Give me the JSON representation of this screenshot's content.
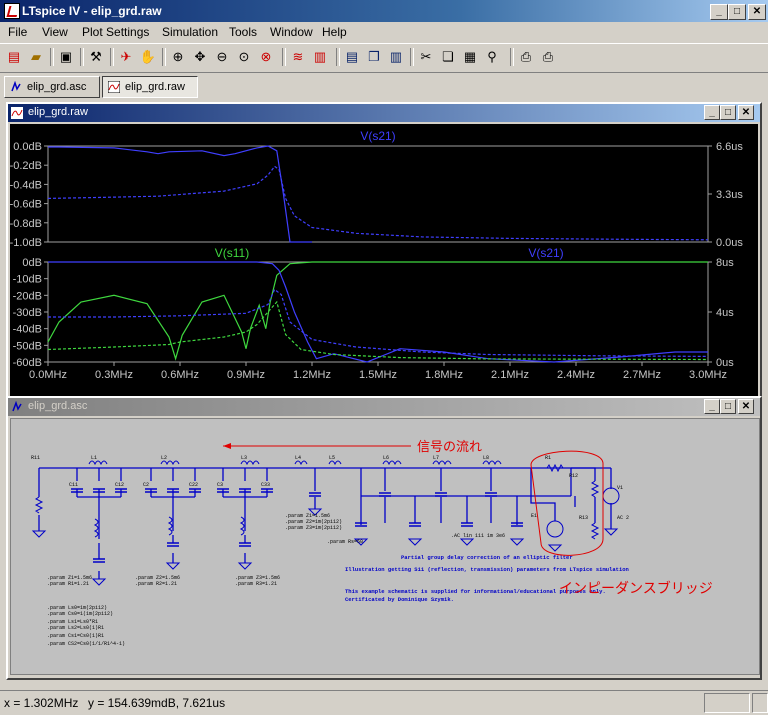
{
  "window": {
    "title": "LTspice IV - elip_grd.raw"
  },
  "menu": [
    "File",
    "View",
    "Plot Settings",
    "Simulation",
    "Tools",
    "Window",
    "Help"
  ],
  "tabs": [
    {
      "label": "elip_grd.asc",
      "active": false
    },
    {
      "label": "elip_grd.raw",
      "active": true
    }
  ],
  "plot_window": {
    "title": "elip_grd.raw",
    "top_pane": {
      "trace_label": "V(s21)",
      "y_ticks": [
        "0.0dB",
        "-0.2dB",
        "-0.4dB",
        "-0.6dB",
        "-0.8dB",
        "-1.0dB"
      ],
      "y2_ticks": [
        "6.6us",
        "3.3us",
        "0.0us"
      ]
    },
    "bottom_pane": {
      "trace_labels": [
        "V(s11)",
        "V(s21)"
      ],
      "y_ticks": [
        "0dB",
        "-10dB",
        "-20dB",
        "-30dB",
        "-40dB",
        "-50dB",
        "-60dB"
      ],
      "y2_ticks": [
        "8us",
        "4us",
        "0us"
      ],
      "x_ticks": [
        "0.0MHz",
        "0.3MHz",
        "0.6MHz",
        "0.9MHz",
        "1.2MHz",
        "1.5MHz",
        "1.8MHz",
        "2.1MHz",
        "2.4MHz",
        "2.7MHz",
        "3.0MHz"
      ]
    },
    "colors": {
      "s21": "#3f3fff",
      "s11": "#3fd83f",
      "axis": "#a0a0a0",
      "label_text": "#c8c8c8"
    }
  },
  "chart_data": [
    {
      "type": "line",
      "title": "",
      "xlabel": "",
      "ylabel": "",
      "xlim": [
        0,
        3.0
      ],
      "ylim": [
        -1.0,
        0.0
      ],
      "y2lim": [
        0,
        6.6
      ],
      "x_unit": "MHz",
      "y_unit": "dB",
      "y2_unit": "us",
      "grid": false,
      "series": [
        {
          "name": "V(s21)",
          "axis": "y",
          "style": "solid",
          "x": [
            0,
            0.05,
            0.3,
            0.45,
            0.5,
            0.55,
            0.7,
            0.8,
            0.85,
            0.95,
            1.0,
            1.04,
            1.07,
            1.1,
            1.15,
            1.2
          ],
          "y": [
            -0.01,
            -0.01,
            -0.02,
            -0.06,
            -0.08,
            -0.06,
            -0.05,
            -0.1,
            -0.08,
            -0.02,
            0.0,
            -0.05,
            -0.5,
            -1.0,
            -1.0,
            -1.0
          ]
        },
        {
          "name": "V(s21)",
          "axis": "y2",
          "style": "dashed",
          "x": [
            0,
            0.2,
            0.5,
            0.8,
            0.95,
            1.0,
            1.03,
            1.05,
            1.08,
            1.12,
            1.2,
            1.4,
            1.7,
            2.1,
            2.5,
            3.0
          ],
          "y": [
            3.0,
            3.05,
            3.15,
            3.5,
            4.0,
            4.6,
            5.2,
            5.0,
            3.0,
            1.8,
            1.0,
            0.6,
            0.35,
            0.25,
            0.2,
            0.15
          ]
        }
      ]
    },
    {
      "type": "line",
      "title": "",
      "xlabel": "",
      "ylabel": "",
      "xlim": [
        0,
        3.0
      ],
      "ylim": [
        -60,
        0
      ],
      "y2lim": [
        0,
        8
      ],
      "x_unit": "MHz",
      "y_unit": "dB",
      "y2_unit": "us",
      "grid": false,
      "series": [
        {
          "name": "V(s11)",
          "axis": "y",
          "style": "solid",
          "x": [
            0,
            0.05,
            0.15,
            0.3,
            0.45,
            0.55,
            0.58,
            0.61,
            0.7,
            0.8,
            0.88,
            0.9,
            0.92,
            0.96,
            0.99,
            1.01,
            1.04,
            1.1,
            1.2,
            1.5,
            2.0,
            3.0
          ],
          "y": [
            -48,
            -36,
            -24,
            -20,
            -25,
            -45,
            -58,
            -44,
            -24,
            -20,
            -42,
            -52,
            -40,
            -26,
            -40,
            -24,
            -8,
            -1,
            0,
            0,
            0,
            0
          ]
        },
        {
          "name": "V(s21)",
          "axis": "y",
          "style": "solid",
          "x": [
            0,
            0.5,
            0.95,
            1.02,
            1.05,
            1.08,
            1.12,
            1.18,
            1.22,
            1.3,
            1.45,
            1.6,
            1.8,
            2.0,
            2.3,
            2.6,
            2.85,
            3.0
          ],
          "y": [
            0,
            0,
            0,
            -1,
            -5,
            -15,
            -30,
            -48,
            -58,
            -55,
            -60,
            -52,
            -54,
            -58,
            -60,
            -57,
            -54,
            -54
          ]
        },
        {
          "name": "V(s21)",
          "axis": "y2",
          "style": "dashed",
          "x": [
            0,
            0.3,
            0.6,
            0.9,
            1.0,
            1.03,
            1.06,
            1.1,
            1.2,
            1.4,
            1.7,
            2.0,
            2.5,
            3.0
          ],
          "y": [
            3.6,
            3.6,
            3.7,
            3.9,
            4.6,
            5.8,
            5.4,
            3.2,
            1.8,
            1.2,
            0.8,
            0.6,
            0.5,
            0.45
          ]
        },
        {
          "name": "V(s11)",
          "axis": "y2",
          "style": "dashed",
          "x": [
            0,
            0.3,
            0.55,
            0.6,
            0.8,
            0.9,
            0.95,
            1.0,
            1.04,
            1.08,
            1.15,
            1.3,
            1.6,
            2.0,
            3.0
          ],
          "y": [
            1.0,
            1.2,
            1.4,
            1.6,
            2.0,
            2.4,
            3.0,
            4.0,
            4.8,
            2.2,
            1.0,
            0.6,
            0.35,
            0.25,
            0.2
          ]
        }
      ]
    }
  ],
  "schematic_window": {
    "title": "elip_grd.asc",
    "annotation_signal_flow": "信号の流れ",
    "annotation_bridge": "インピーダンスブリッジ",
    "comment_lines": [
      "Partial group delay correction of an elliptic filter",
      "Illustration getting S11 (reflection, transmission) parameters from LTspice simulation",
      "This example schematic is supplied for informational/educational purposes only.",
      "Certificated by Dominique Szymik."
    ],
    "params": [
      ".param Z1=1.5m6",
      ".param R1=1.21",
      ".param Z2=1.5m6",
      ".param R2=1.21",
      ".param Z3=1.5m6",
      ".param R3=1.21",
      ".param Z1=1.5m6",
      ".param Z2=1m(2pi12)",
      ".param Z3=1m(2pi12)",
      ".param Rs=50",
      ".AC lin 111 1m 3e6",
      ".param Ls0=1m(2pi12)",
      ".param Cs0=1(1m(2pi12)",
      ".param Ls1=Ls0*R1",
      ".param Ls2=Ls0(1)R1",
      ".param Cs1=Cs0(1)R1",
      ".param CS2=Cs0(1/1/R1^4-1)"
    ],
    "components": [
      "R11",
      "L1",
      "C11",
      "C12",
      "L2",
      "C2",
      "C22",
      "L3",
      "C3",
      "C33",
      "L4",
      "L5",
      "L6",
      "L7",
      "L8",
      "C4",
      "C5",
      "C6",
      "C7",
      "C8",
      "C9",
      "R1",
      "R12",
      "R13",
      "E1",
      "V1",
      "AC 2"
    ],
    "net_color": "#0000c8",
    "comment_color": "#0000c8",
    "annotation_color": "#e00000"
  },
  "statusbar": {
    "x": "x = 1.302MHz",
    "y": "y = 154.639mdB, 7.621us"
  }
}
